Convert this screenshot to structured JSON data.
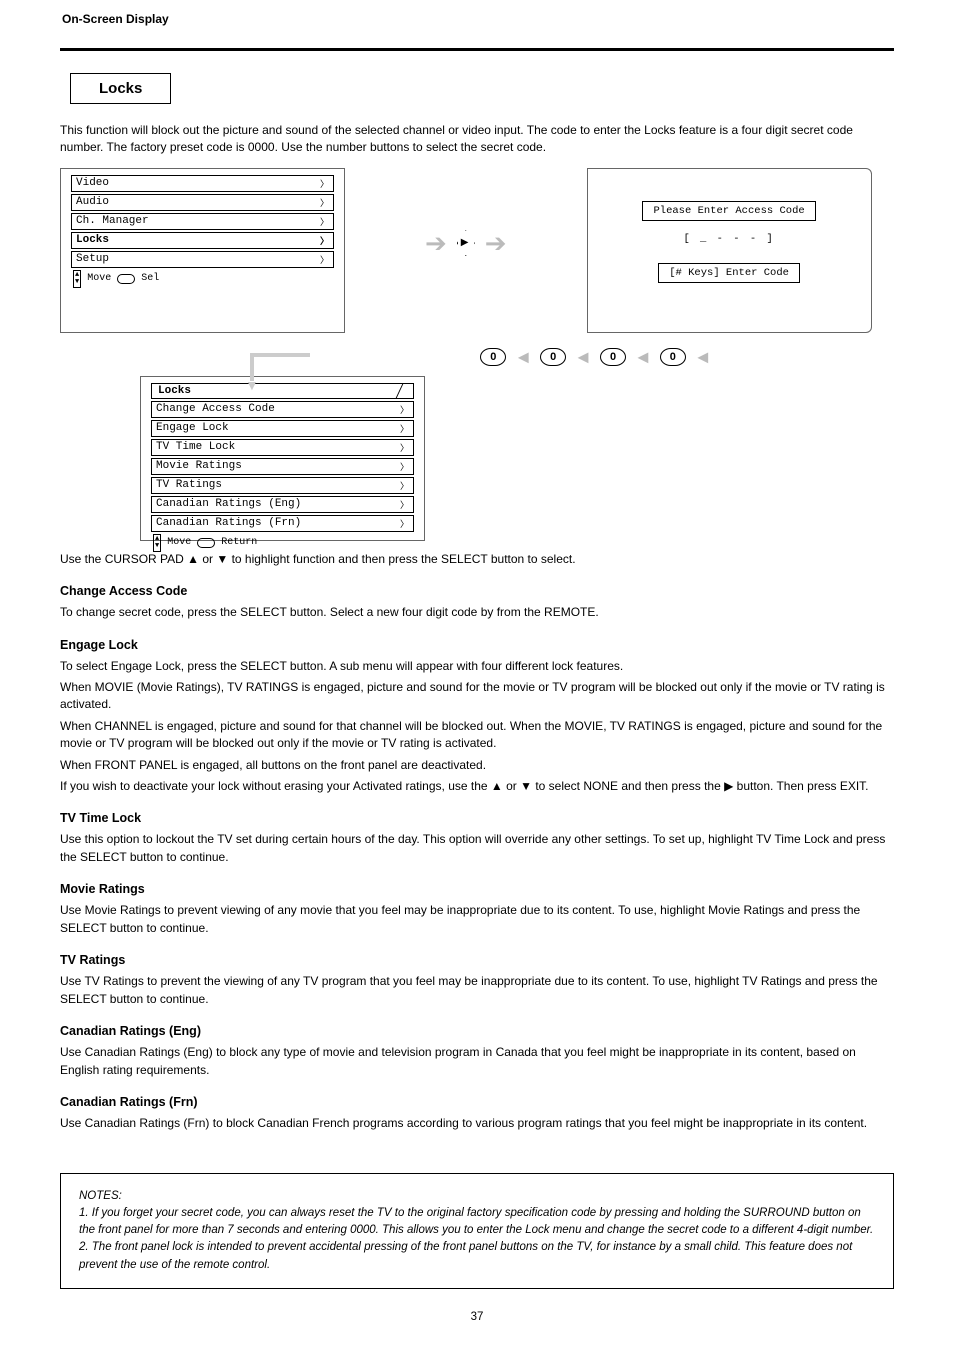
{
  "header": {
    "title": "On-Screen Display",
    "page_number": "37"
  },
  "tab_label": "Locks",
  "intro": "This function will block out the picture and sound of the selected channel or video input. The code to enter the Locks feature is a four digit secret code number. The factory preset code is 0000. Use the number buttons to select the secret code.",
  "screens": {
    "main_menu": {
      "items": [
        "Video",
        "Audio",
        "Ch. Manager",
        "Locks",
        "Setup"
      ],
      "hint_move": "Move",
      "hint_sel": "Sel"
    },
    "access": {
      "title": "Please Enter Access Code",
      "code_display": "[ _ - - - ]",
      "hint": "[# Keys] Enter Code"
    },
    "locks_menu": {
      "title": "Locks",
      "items": [
        "Change Access Code",
        "Engage Lock",
        "TV Time Lock",
        "Movie Ratings",
        "TV Ratings",
        "Canadian Ratings (Eng)",
        "Canadian Ratings (Frn)"
      ],
      "hint_move": "Move",
      "hint_return": "Return"
    }
  },
  "zero_label": "0",
  "after_menu": "Use the CURSOR PAD ▲ or ▼ to highlight function and then press the SELECT button to select.",
  "sections": {
    "change_code": {
      "h": "Change Access Code",
      "p": "To change secret code, press the SELECT button. Select a new four digit code by from the REMOTE."
    },
    "engage": {
      "h": "Engage Lock",
      "p1": "To select Engage Lock, press the SELECT button. A sub menu will appear with four different lock features.",
      "p2": "When MOVIE (Movie Ratings), TV RATINGS is engaged, picture and sound for the movie or TV program will be blocked out only if the movie or TV rating is activated.",
      "p3": "When CHANNEL is engaged, picture and sound for that channel will be blocked out. When the MOVIE, TV RATINGS is engaged, picture and sound for the movie or TV program will be blocked out only if the movie or TV rating is activated.",
      "p4": "When FRONT PANEL is engaged, all buttons on the front panel are deactivated.",
      "p5": "If you wish to deactivate your lock without erasing your Activated ratings, use the ▲ or ▼ to select NONE and then press the ▶ button. Then press EXIT."
    },
    "tv_time": {
      "h": "TV Time Lock",
      "p": "Use this option to lockout the TV set during certain hours of the day. This option will override any other settings. To set up, highlight TV Time Lock and press the SELECT button to continue."
    },
    "movie": {
      "h": "Movie Ratings",
      "p": "Use Movie Ratings to prevent viewing of any movie that you feel may be inappropriate due to its content. To use, highlight Movie Ratings and press the SELECT button to continue."
    },
    "tvr": {
      "h": "TV Ratings",
      "p": "Use TV Ratings to prevent the viewing of any TV program that you feel may be inappropriate due to its content. To use, highlight TV Ratings and press the SELECT button to continue."
    },
    "ceng": {
      "h": "Canadian Ratings (Eng)",
      "p": "Use Canadian Ratings (Eng) to block any type of movie and television program in Canada that you feel might be inappropriate in its content, based on English rating requirements."
    },
    "cfrn": {
      "h": "Canadian Ratings (Frn)",
      "p": "Use Canadian Ratings (Frn) to block Canadian French programs according to various program ratings that you feel might be inappropriate in its content."
    }
  },
  "notes": {
    "n1": "1. If you forget your secret code, you can always reset the TV to the original factory specification code by pressing and holding the SURROUND button on the front panel for more than 7 seconds and entering 0000. This allows you to enter the Lock menu and change the secret code to a different 4-digit number.",
    "n2": "2. The front panel lock is intended to prevent accidental pressing of the front panel buttons on the TV, for instance by a small child. This feature does not prevent the use of the remote control."
  }
}
